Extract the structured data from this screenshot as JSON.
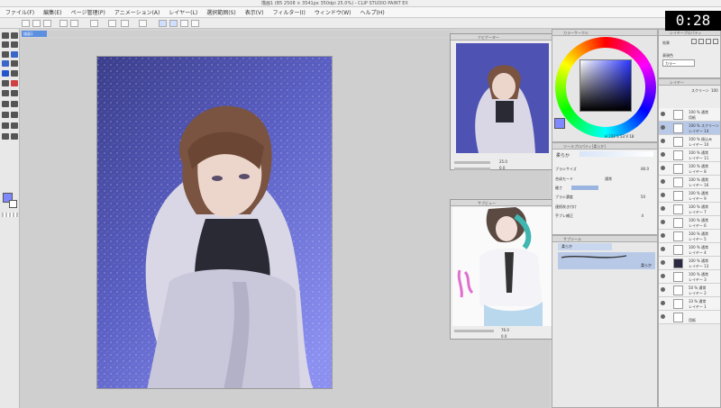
{
  "window": {
    "title": "描画1 (B5 2508 × 3541px 350dpi 25.0%) - CLIP STUDIO PAINT EX"
  },
  "menu": [
    "ファイル(F)",
    "編集(E)",
    "ページ管理(P)",
    "アニメーション(A)",
    "レイヤー(L)",
    "選択範囲(S)",
    "表示(V)",
    "フィルター(I)",
    "ウィンドウ(W)",
    "ヘルプ(H)"
  ],
  "canvas_tab": {
    "label": "描画1"
  },
  "timer": {
    "text": "0:28"
  },
  "panels": {
    "navigator": {
      "title": "ナビゲーター",
      "zoom": "25.0",
      "rotate": "0.0"
    },
    "reference": {
      "title": "サブビュー",
      "zoom": "76.0",
      "rotate": "0.0"
    },
    "color_circle": {
      "title": "カラーサークル",
      "readout": "H 232  S 53  V 18"
    },
    "tool_property": {
      "title": "ツールプロパティ[柔らか]",
      "tool_name": "柔らか",
      "rows": [
        {
          "label": "ブラシサイズ",
          "value": "80.0"
        },
        {
          "label": "合成モード",
          "value": "通常"
        },
        {
          "label": "硬さ",
          "value": ""
        },
        {
          "label": "ブラシ濃度",
          "value": "50"
        },
        {
          "label": "連続吹き付け",
          "value": ""
        },
        {
          "label": "手ブレ補正",
          "value": "4"
        }
      ]
    },
    "sub_tool": {
      "title": "サブツール",
      "items": [
        "柔らか",
        "柔らか"
      ]
    },
    "layer_property": {
      "title": "レイヤープロパティ",
      "effect_label": "効果",
      "color_label": "表現色",
      "color_value": "カラー"
    },
    "layers": {
      "title": "レイヤー",
      "blend": "スクリーン",
      "opacity": "100"
    }
  },
  "layers": [
    {
      "mode": "100 % 通常",
      "name": "用紙"
    },
    {
      "mode": "100 % スクリーン",
      "name": "レイヤー 14"
    },
    {
      "mode": "100 % 焼込み",
      "name": "レイヤー 10"
    },
    {
      "mode": "100 % 通常",
      "name": "レイヤー 11"
    },
    {
      "mode": "100 % 通常",
      "name": "レイヤー 8"
    },
    {
      "mode": "100 % 通常",
      "name": "レイヤー 16"
    },
    {
      "mode": "100 % 通常",
      "name": "レイヤー 9"
    },
    {
      "mode": "100 % 通常",
      "name": "レイヤー 7"
    },
    {
      "mode": "100 % 通常",
      "name": "レイヤー 6"
    },
    {
      "mode": "100 % 通常",
      "name": "レイヤー 5"
    },
    {
      "mode": "100 % 通常",
      "name": "レイヤー 4"
    },
    {
      "mode": "100 % 通常",
      "name": "レイヤー 13"
    },
    {
      "mode": "100 % 通常",
      "name": "レイヤー 3"
    },
    {
      "mode": "50 % 通常",
      "name": "レイヤー 2"
    },
    {
      "mode": "33 % 通常",
      "name": "レイヤー 1"
    },
    {
      "mode": "",
      "name": "用紙"
    }
  ],
  "colors": {
    "main": "#7f88ff",
    "sub": "#ffffff",
    "accent": "#5b8fe0"
  }
}
